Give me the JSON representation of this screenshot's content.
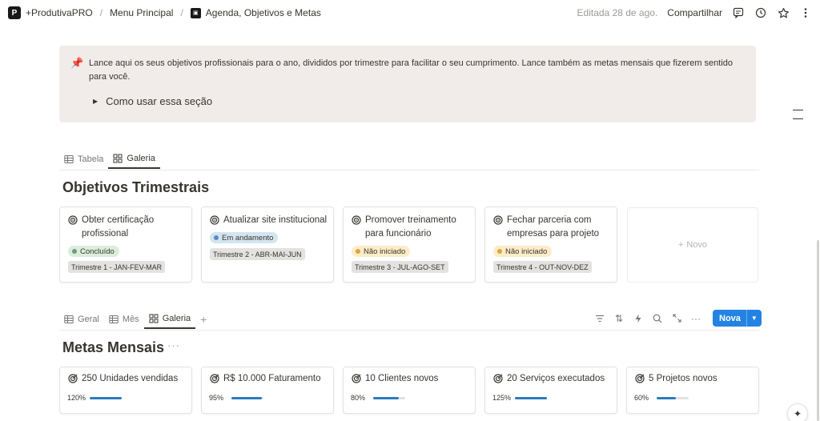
{
  "breadcrumb": {
    "workspace": "+ProdutivaPRO",
    "parent": "Menu Principal",
    "current": "Agenda, Objetivos e Metas"
  },
  "header": {
    "edited": "Editada 28 de ago.",
    "share_label": "Compartilhar"
  },
  "callout": {
    "text": "Lance aqui os seus objetivos profissionais para o ano, divididos por trimestre para facilitar o seu cumprimento. Lance também as metas mensais que fizerem sentido para você.",
    "toggle_label": "Como usar essa seção"
  },
  "objectives_tabs": [
    {
      "label": "Tabela"
    },
    {
      "label": "Galeria"
    }
  ],
  "objectives": {
    "title": "Objetivos Trimestrais",
    "new_label": "Novo",
    "cards": [
      {
        "title": "Obter certificação profissional",
        "status": "Concluído",
        "status_color": "#6c9b7d",
        "status_bg": "#dbeddb",
        "quarter": "Trimestre 1 - JAN-FEV-MAR"
      },
      {
        "title": "Atualizar site institucional",
        "status": "Em andamento",
        "status_color": "#5e87c9",
        "status_bg": "#d3e5ef",
        "quarter": "Trimestre 2 - ABR-MAI-JUN"
      },
      {
        "title": "Promover treinamento para funcionário",
        "status": "Não iniciado",
        "status_color": "#d9a641",
        "status_bg": "#fdecc8",
        "quarter": "Trimestre 3 - JUL-AGO-SET"
      },
      {
        "title": "Fechar parceria com empresas para projeto",
        "status": "Não iniciado",
        "status_color": "#d9a641",
        "status_bg": "#fdecc8",
        "quarter": "Trimestre 4 - OUT-NOV-DEZ"
      }
    ]
  },
  "goals_tabs": [
    {
      "label": "Geral"
    },
    {
      "label": "Mês"
    },
    {
      "label": "Galeria"
    }
  ],
  "toolbar": {
    "new_label": "Nova"
  },
  "goals": {
    "title": "Metas Mensais",
    "cards": [
      {
        "title": "250 Unidades vendidas",
        "percent": "120%",
        "progress": 1.0
      },
      {
        "title": "R$ 10.000 Faturamento",
        "percent": "95%",
        "progress": 0.95
      },
      {
        "title": "10 Clientes novos",
        "percent": "80%",
        "progress": 0.8
      },
      {
        "title": "20 Serviços executados",
        "percent": "125%",
        "progress": 1.0
      },
      {
        "title": "5 Projetos novos",
        "percent": "60%",
        "progress": 0.6
      }
    ]
  },
  "colors": {
    "accent": "#2383e2",
    "progress": "#2e7bbd"
  }
}
